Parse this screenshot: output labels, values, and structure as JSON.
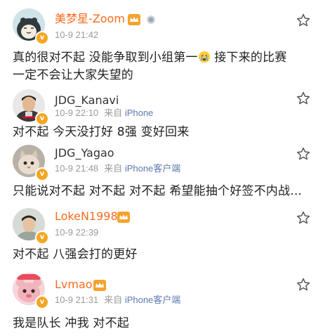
{
  "comments": [
    {
      "username": "美梦星-Zoom",
      "timestamp": "10-9 21:42",
      "source_prefix": "",
      "source_device": "",
      "text_part1": "真的很对不起 没能争取到小组第一",
      "text_emoji": "crying-face",
      "text_part2": " 接下来的比赛",
      "text_line2": "一定不会让大家失望的",
      "badges": [
        "vip-crown",
        "medal"
      ],
      "like_icon": "star-outline-icon"
    },
    {
      "username": "JDG_Kanavi",
      "timestamp": "10-9 22:10",
      "source_prefix": "来自",
      "source_device": "iPhone",
      "text": "对不起 今天没打好 8强 变好回来",
      "like_icon": "star-outline-icon"
    },
    {
      "username": "JDG_Yagao",
      "timestamp": "10-9 21:48",
      "source_prefix": "来自",
      "source_device": "iPhone客户端",
      "text": "只能说对不起 对不起 对不起 希望能抽个好签不内战...",
      "like_icon": "star-outline-icon"
    },
    {
      "username": "LokeN1998",
      "timestamp": "10-9 22:39",
      "source_prefix": "",
      "source_device": "",
      "text": "对不起 八强会打的更好",
      "badges": [
        "vip-crown"
      ],
      "like_icon": "star-outline-icon"
    },
    {
      "username": "Lvmao",
      "timestamp": "10-9 21:31",
      "source_prefix": "来自",
      "source_device": "iPhone客户端",
      "text": "我是队长 冲我 对不起",
      "badges": [
        "vip-crown"
      ],
      "like_icon": "star-outline-icon"
    }
  ],
  "colors": {
    "vip_username": "#f86b20",
    "normal_username": "#333333",
    "meta_text": "#9a9a9a",
    "source_device": "#5b7bb0",
    "verified_badge": "#f5a623",
    "body_text": "#222222"
  }
}
